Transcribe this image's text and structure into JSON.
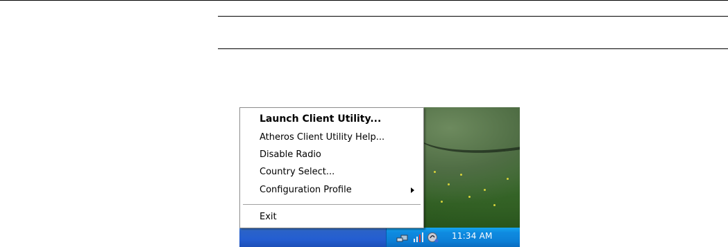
{
  "menu": {
    "items": [
      {
        "label": "Launch Client Utility...",
        "bold": true,
        "submenu": false
      },
      {
        "label": "Atheros Client Utility Help...",
        "bold": false,
        "submenu": false
      },
      {
        "label": "Disable Radio",
        "bold": false,
        "submenu": false
      },
      {
        "label": "Country Select...",
        "bold": false,
        "submenu": false
      },
      {
        "label": "Configuration Profile",
        "bold": false,
        "submenu": true
      }
    ],
    "exit_label": "Exit"
  },
  "tray": {
    "clock": "11:34 AM",
    "icons": [
      "network-connection-icon",
      "signal-strength-icon",
      "atheros-utility-icon"
    ]
  },
  "colors": {
    "taskbar": "#245ed1",
    "tray": "#0f8be0",
    "menu_background": "#ffffff"
  }
}
